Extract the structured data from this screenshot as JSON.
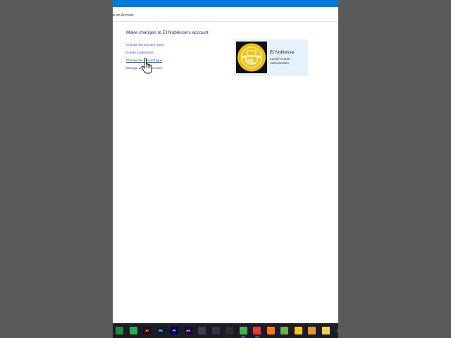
{
  "breadcrumb": {
    "text": "ge an Account"
  },
  "page": {
    "heading": "Make changes to El Noblesse's account",
    "links": [
      "Change the account name",
      "Create a password",
      "Change the account type",
      "Manage another account"
    ]
  },
  "account": {
    "name": "El Noblesse",
    "type": "Local Account",
    "role": "Administrator",
    "avatar_icon": "gold-emblem-logo"
  },
  "colors": {
    "titlebar": "#0078d7",
    "heading": "#1e3287",
    "link": "#1a5cb3",
    "card_bg": "#e5f1fb",
    "taskbar": "#1b1c27",
    "emblem": "#f0c419"
  },
  "taskbar": {
    "icons": [
      {
        "name": "spreadsheet-app-icon",
        "label": "",
        "color": "#1e8e3e"
      },
      {
        "name": "messaging-app-icon",
        "label": "",
        "color": "#22b14c"
      },
      {
        "name": "illustrator-icon",
        "label": "Ai",
        "color": "#330000"
      },
      {
        "name": "photoshop-icon",
        "label": "Ps",
        "color": "#001e36"
      },
      {
        "name": "premiere-icon",
        "label": "Pr",
        "color": "#00005b"
      },
      {
        "name": "after-effects-icon",
        "label": "Ae",
        "color": "#1f0040"
      },
      {
        "name": "davinci-resolve-icon",
        "label": "",
        "color": "#3a3f4b"
      },
      {
        "name": "davinci-fusion-icon",
        "label": "",
        "color": "#2f3440"
      },
      {
        "name": "obs-icon",
        "label": "",
        "color": "#302e31"
      },
      {
        "name": "camtasia-icon",
        "label": "",
        "color": "#4caf50"
      },
      {
        "name": "camtasia-recorder-icon",
        "label": "",
        "color": "#e53935"
      },
      {
        "name": "adobe-app-icon",
        "label": "",
        "color": "#ff7a00"
      },
      {
        "name": "shield-app-icon",
        "label": "",
        "color": "#6ab04c"
      },
      {
        "name": "triangle-app-icon",
        "label": "",
        "color": "#f5c518"
      },
      {
        "name": "audio-app-icon",
        "label": "",
        "color": "#e09a2b"
      },
      {
        "name": "notes-app-icon",
        "label": "",
        "color": "#f3d24a"
      },
      {
        "name": "vegas-app-icon",
        "label": "AV",
        "color": "#222222"
      }
    ]
  }
}
